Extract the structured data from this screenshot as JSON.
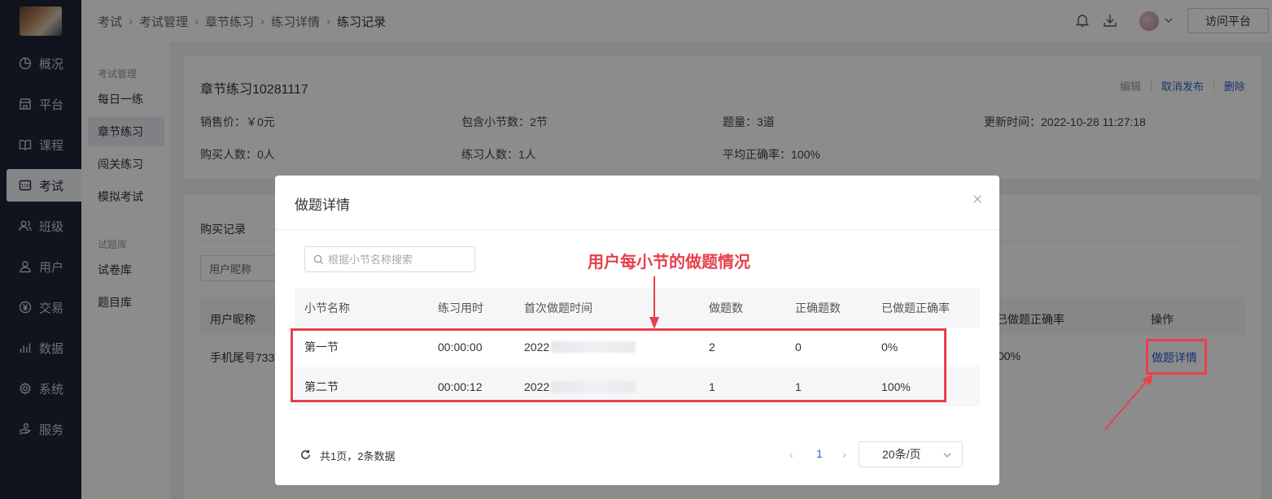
{
  "sidenav": {
    "items": [
      {
        "label": "概况",
        "icon": "pie-chart-icon"
      },
      {
        "label": "平台",
        "icon": "store-icon"
      },
      {
        "label": "课程",
        "icon": "book-icon"
      },
      {
        "label": "考试",
        "icon": "exam-icon"
      },
      {
        "label": "班级",
        "icon": "group-icon"
      },
      {
        "label": "用户",
        "icon": "user-icon"
      },
      {
        "label": "交易",
        "icon": "yen-circle-icon"
      },
      {
        "label": "数据",
        "icon": "bar-chart-icon"
      },
      {
        "label": "系统",
        "icon": "gear-icon"
      },
      {
        "label": "服务",
        "icon": "service-icon"
      }
    ],
    "active": "考试"
  },
  "breadcrumb": [
    "考试",
    "考试管理",
    "章节练习",
    "练习详情",
    "练习记录"
  ],
  "topbar": {
    "visit_label": "访问平台"
  },
  "subnav": {
    "group1": "考试管理",
    "group1_items": [
      "每日一练",
      "章节练习",
      "闯关练习",
      "模拟考试"
    ],
    "group2": "试题库",
    "group2_items": [
      "试卷库",
      "题目库"
    ],
    "active": "章节练习"
  },
  "summary": {
    "title": "章节练习10281117",
    "actions": {
      "edit": "编辑",
      "unpublish": "取消发布",
      "delete": "删除"
    },
    "price": "销售价：￥0元",
    "sections": "包含小节数：2节",
    "questions": "题量：3道",
    "updated": "更新时间：2022-10-28 11:27:18",
    "buyers": "购买人数：0人",
    "practicers": "练习人数：1人",
    "avg_accuracy": "平均正确率：100%"
  },
  "records": {
    "tab": "购买记录",
    "filter": "用户昵称",
    "col_user": "用户昵称",
    "col_rate": "已做题正确率",
    "col_action": "操作",
    "row_user": "手机尾号733",
    "row_rate": "00%",
    "row_action": "做题详情"
  },
  "modal": {
    "title": "做题详情",
    "search_placeholder": "根据小节名称搜索",
    "columns": [
      "小节名称",
      "练习用时",
      "首次做题时间",
      "做题数",
      "正确题数",
      "已做题正确率"
    ],
    "rows": [
      {
        "name": "第一节",
        "duration": "00:00:00",
        "first_time": "2022",
        "count": "2",
        "correct": "0",
        "rate": "0%"
      },
      {
        "name": "第二节",
        "duration": "00:00:12",
        "first_time": "2022",
        "count": "1",
        "correct": "1",
        "rate": "100%"
      }
    ],
    "total": "共1页，2条数据",
    "page": "1",
    "prev": "‹",
    "next": "›",
    "page_size": "20条/页"
  },
  "annotation": {
    "text": "用户每小节的做题情况",
    "color": "#e8404c"
  }
}
